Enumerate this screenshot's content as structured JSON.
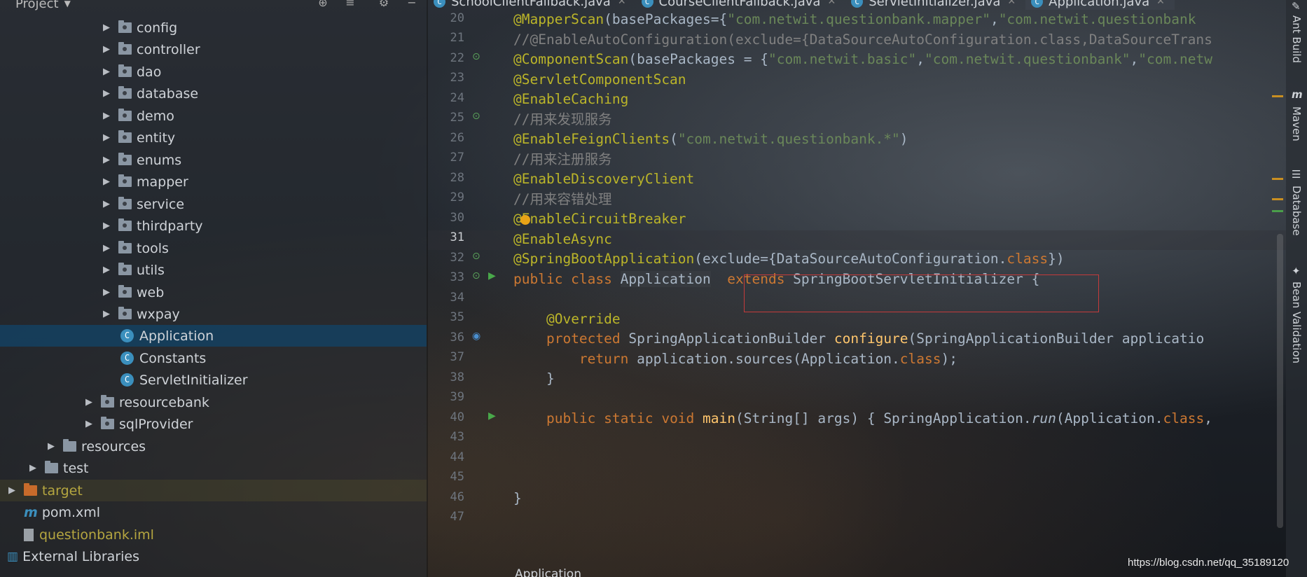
{
  "project_panel": {
    "title": "Project",
    "tree": [
      {
        "label": "config",
        "kind": "package"
      },
      {
        "label": "controller",
        "kind": "package"
      },
      {
        "label": "dao",
        "kind": "package"
      },
      {
        "label": "database",
        "kind": "package"
      },
      {
        "label": "demo",
        "kind": "package"
      },
      {
        "label": "entity",
        "kind": "package"
      },
      {
        "label": "enums",
        "kind": "package"
      },
      {
        "label": "mapper",
        "kind": "package"
      },
      {
        "label": "service",
        "kind": "package"
      },
      {
        "label": "thirdparty",
        "kind": "package"
      },
      {
        "label": "tools",
        "kind": "package"
      },
      {
        "label": "utils",
        "kind": "package"
      },
      {
        "label": "web",
        "kind": "package"
      },
      {
        "label": "wxpay",
        "kind": "package"
      },
      {
        "label": "Application",
        "kind": "class",
        "selected": true
      },
      {
        "label": "Constants",
        "kind": "class"
      },
      {
        "label": "ServletInitializer",
        "kind": "class"
      },
      {
        "label": "resourcebank",
        "kind": "package"
      },
      {
        "label": "sqlProvider",
        "kind": "package"
      },
      {
        "label": "resources",
        "kind": "folder"
      },
      {
        "label": "test",
        "kind": "folder"
      },
      {
        "label": "target",
        "kind": "folder-orange"
      },
      {
        "label": "pom.xml",
        "kind": "maven"
      },
      {
        "label": "questionbank.iml",
        "kind": "iml"
      },
      {
        "label": "External Libraries",
        "kind": "libs"
      }
    ]
  },
  "tabs": [
    {
      "label": "SchoolClientFallback.java"
    },
    {
      "label": "CourseClientFallback.java"
    },
    {
      "label": "ServletInitializer.java"
    },
    {
      "label": "Application.java",
      "active": true
    }
  ],
  "editor": {
    "line_numbers": [
      "20",
      "21",
      "22",
      "23",
      "24",
      "25",
      "26",
      "27",
      "28",
      "29",
      "30",
      "31",
      "32",
      "33",
      "34",
      "35",
      "36",
      "37",
      "38",
      "39",
      "40",
      "43",
      "44",
      "45",
      "46",
      "47"
    ],
    "current_line": "31",
    "breadcrumb": "Application"
  },
  "right_toolbar": [
    "Ant Build",
    "Maven",
    "Database",
    "Bean Validation"
  ],
  "watermark": "https://blog.csdn.net/qq_35189120",
  "colors": {
    "annotation": "#bbb529",
    "string": "#6a8759",
    "keyword": "#cc7832",
    "comment": "#808080",
    "method": "#ffc66d",
    "selection": "#114468",
    "highlight_box": "#c43b3b"
  }
}
